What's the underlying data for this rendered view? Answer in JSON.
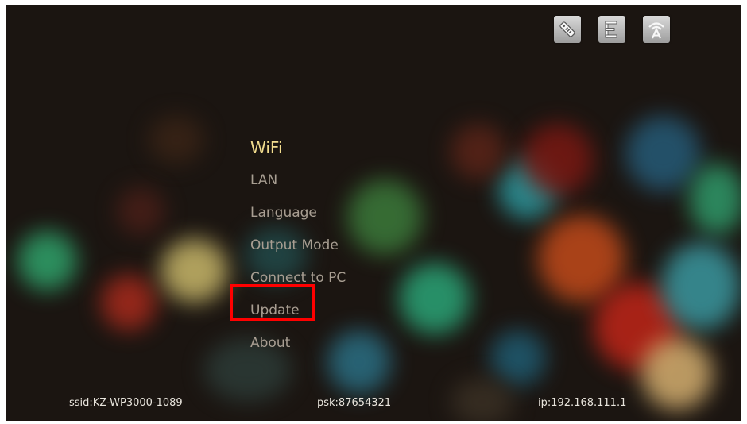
{
  "toolbar": {
    "icons": [
      "remote-icon",
      "network-tree-icon",
      "wifi-signal-icon"
    ]
  },
  "menu": {
    "items": [
      {
        "label": "WiFi"
      },
      {
        "label": "LAN"
      },
      {
        "label": "Language"
      },
      {
        "label": "Output Mode"
      },
      {
        "label": "Connect to PC"
      },
      {
        "label": "Update"
      },
      {
        "label": "About"
      }
    ],
    "selected_index": 0,
    "highlighted_label": "Update"
  },
  "status_bar": {
    "ssid": "ssid:KZ-WP3000-1089",
    "psk": "psk:87654321",
    "ip": "ip:192.168.111.1"
  },
  "colors": {
    "menu_selected": "#f2dc8e",
    "menu_normal": "#a89e92",
    "highlight_box": "#ff0000"
  }
}
